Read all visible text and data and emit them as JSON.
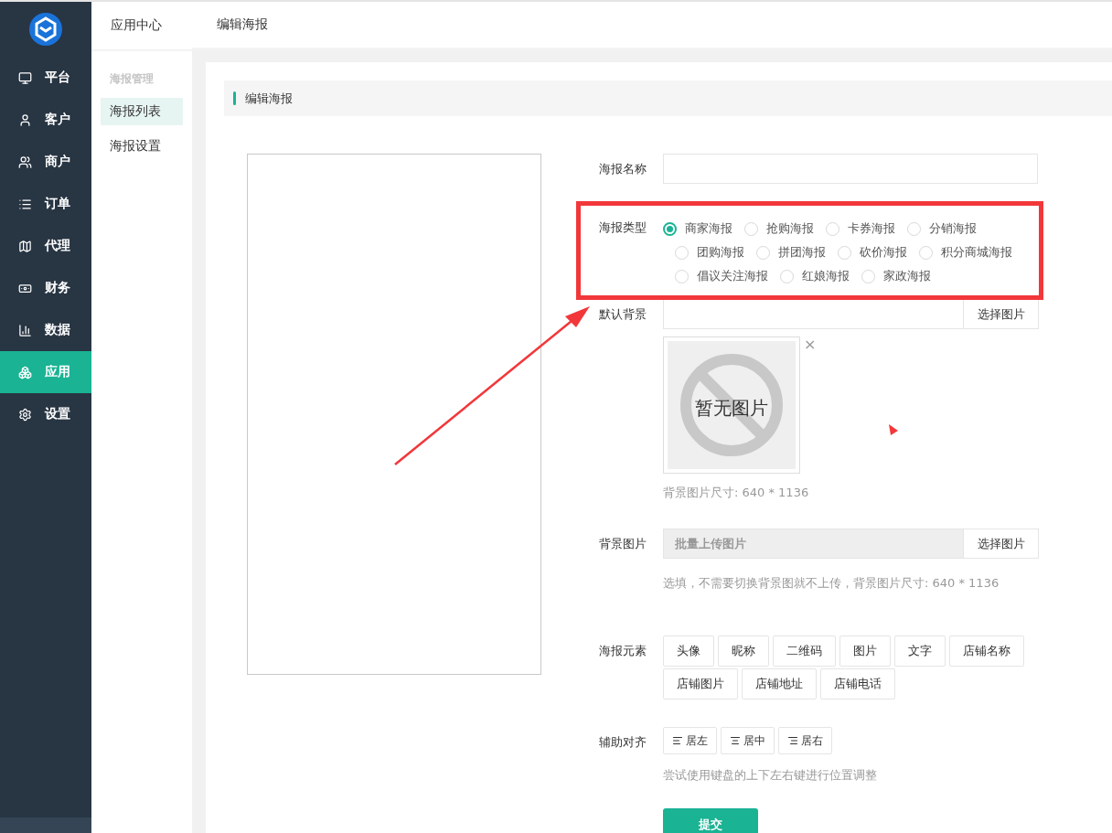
{
  "sidebar": {
    "items": [
      {
        "label": "平台",
        "selected": false
      },
      {
        "label": "客户",
        "selected": false
      },
      {
        "label": "商户",
        "selected": false
      },
      {
        "label": "订单",
        "selected": false
      },
      {
        "label": "代理",
        "selected": false
      },
      {
        "label": "财务",
        "selected": false
      },
      {
        "label": "数据",
        "selected": false
      },
      {
        "label": "应用",
        "selected": true
      },
      {
        "label": "设置",
        "selected": false
      }
    ]
  },
  "subnav": {
    "title": "应用中心",
    "section": "海报管理",
    "items": [
      {
        "label": "海报列表",
        "selected": true
      },
      {
        "label": "海报设置",
        "selected": false
      }
    ]
  },
  "header": {
    "breadcrumb": "编辑海报"
  },
  "panel": {
    "title": "编辑海报"
  },
  "form": {
    "name": {
      "label": "海报名称"
    },
    "type": {
      "label": "海报类型",
      "options": [
        {
          "label": "商家海报",
          "selected": true
        },
        {
          "label": "抢购海报",
          "selected": false
        },
        {
          "label": "卡券海报",
          "selected": false
        },
        {
          "label": "分销海报",
          "selected": false
        },
        {
          "label": "团购海报",
          "selected": false
        },
        {
          "label": "拼团海报",
          "selected": false
        },
        {
          "label": "砍价海报",
          "selected": false
        },
        {
          "label": "积分商城海报",
          "selected": false
        },
        {
          "label": "倡议关注海报",
          "selected": false
        },
        {
          "label": "红娘海报",
          "selected": false
        },
        {
          "label": "家政海报",
          "selected": false
        }
      ]
    },
    "default_bg": {
      "label": "默认背景",
      "button": "选择图片",
      "image_text": "暂无图片",
      "close": "×",
      "hint": "背景图片尺寸: 640 * 1136"
    },
    "bg_images": {
      "label": "背景图片",
      "placeholder": "批量上传图片",
      "button": "选择图片",
      "hint": "选填，不需要切换背景图就不上传，背景图片尺寸: 640 * 1136"
    },
    "elements": {
      "label": "海报元素",
      "buttons": [
        "头像",
        "昵称",
        "二维码",
        "图片",
        "文字",
        "店铺名称",
        "店铺图片",
        "店铺地址",
        "店铺电话"
      ]
    },
    "align": {
      "label": "辅助对齐",
      "buttons": [
        "居左",
        "居中",
        "居右"
      ],
      "hint": "尝试使用键盘的上下左右键进行位置调整"
    },
    "submit": "提交"
  }
}
